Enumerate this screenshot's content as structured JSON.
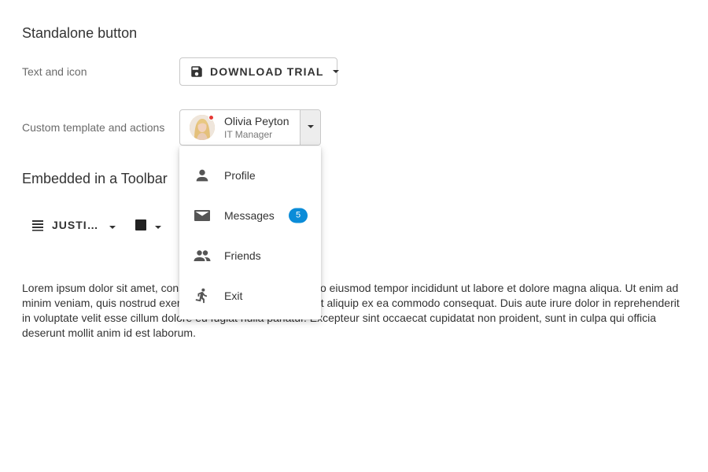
{
  "sections": {
    "standalone_title": "Standalone button",
    "toolbar_title": "Embedded in a Toolbar"
  },
  "rows": {
    "text_icon_label": "Text and icon",
    "custom_template_label": "Custom template and actions"
  },
  "download_button": {
    "label": "DOWNLOAD TRIAL",
    "icon": "save-icon"
  },
  "user": {
    "name": "Olivia Peyton",
    "role": "IT Manager",
    "status_color": "#e53935"
  },
  "menu": {
    "items": [
      {
        "label": "Profile",
        "icon": "person-icon"
      },
      {
        "label": "Messages",
        "icon": "mail-icon",
        "badge": "5"
      },
      {
        "label": "Friends",
        "icon": "group-icon"
      },
      {
        "label": "Exit",
        "icon": "run-icon"
      }
    ]
  },
  "toolbar": {
    "align_label": "JUSTI…",
    "align_icon": "justify-icon",
    "color_icon": "color-square-icon"
  },
  "body_text": "Lorem ipsum dolor sit amet, consectetur adipiscing elit, sed do eiusmod tempor incididunt ut labore et dolore magna aliqua. Ut enim ad minim veniam, quis nostrud exercitation ullamco laboris nisi ut aliquip ex ea commodo consequat. Duis aute irure dolor in reprehenderit in voluptate velit esse cillum dolore eu fugiat nulla pariatur. Excepteur sint occaecat cupidatat non proident, sunt in culpa qui officia deserunt mollit anim id est laborum.",
  "colors": {
    "badge": "#0b8cd8",
    "border": "#c8c8c8",
    "toggle_bg": "#ededed"
  }
}
